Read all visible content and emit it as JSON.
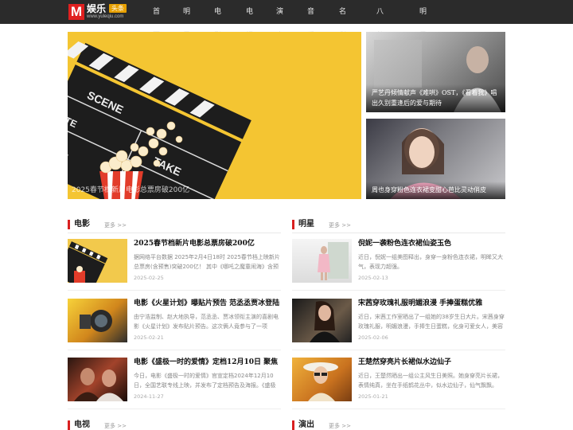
{
  "header": {
    "logo": {
      "letter": "M",
      "name": "娱乐",
      "badge": "头条",
      "url": "www.yuleqiu.com"
    },
    "nav": [
      "首页",
      "明星",
      "电影",
      "电视",
      "演出",
      "音乐",
      "名利场",
      "八卦万象",
      "明星花边"
    ]
  },
  "hero": {
    "main_caption": "2025春节档新片电影总票房破200亿",
    "side": [
      {
        "title": "严艺丹倾情献声《难哄》OST，《看着我》唱出久别重逢后的爱与期待"
      },
      {
        "title": "周也身穿粉色连衣裙变甜心芭比灵动俏皮"
      }
    ]
  },
  "sections": [
    {
      "title": "电影",
      "more": "更多 >>",
      "items": [
        {
          "title": "2025春节档新片电影总票房破200亿",
          "desc": "据网络平台数据 2025年2月4日18时 2025春节档上映新片总票房(含预售)突破200亿！ 其中《哪吒之魔童闹海》含预",
          "date": "2025-02-25"
        },
        {
          "title": "电影《火星计划》曝贴片预告 范丞丞贾冰登陆",
          "desc": "由宁浩监制、赵大地执导，范丞丞、贾冰领衔主演的喜剧电影《火星计划》发布贴片预告。这次俩人竟参与了一项",
          "date": "2025-02-21"
        },
        {
          "title": "电影《盛极一时的爱情》定档12月10日 聚焦",
          "desc": "今日，电影《盛极一时的爱情》官宣定档2024年12月10日，全国艺联专线上映，并发布了定档预告及海报。《盛极一时",
          "date": "2024-11-27"
        }
      ]
    },
    {
      "title": "明星",
      "more": "更多 >>",
      "items": [
        {
          "title": "倪妮一袭粉色连衣裙仙姿玉色",
          "desc": "近日，倪妮一组美图释出，身穿一身粉色连衣裙，明眸又大气，表现力超强。",
          "date": "2025-02-13"
        },
        {
          "title": "宋茜穿玫瑰礼服明媚浪漫 手捧蛋糕优雅",
          "desc": "近日，宋茜工作室晒出了一组她的38岁生日大片。宋茜身穿玫瑰礼服，明媚浪漫，手捧生日蛋糕，化身可爱女人，美容",
          "date": "2025-02-06"
        },
        {
          "title": "王楚然穿亮片长裙似水边仙子",
          "desc": "近日，王楚然晒出一组公主风生日美照。她身穿亮片长裙，表情纯真，坐在手纸鹤花丛中，似水边仙子，仙气飘飘。",
          "date": "2025-01-21"
        }
      ]
    },
    {
      "title": "电视",
      "more": "更多 >>"
    },
    {
      "title": "演出",
      "more": "更多 >>"
    }
  ],
  "colors": {
    "accent": "#d92020",
    "header_bg": "#2b2b2b",
    "hero_bg": "#f4c532",
    "badge": "#e8a000"
  }
}
